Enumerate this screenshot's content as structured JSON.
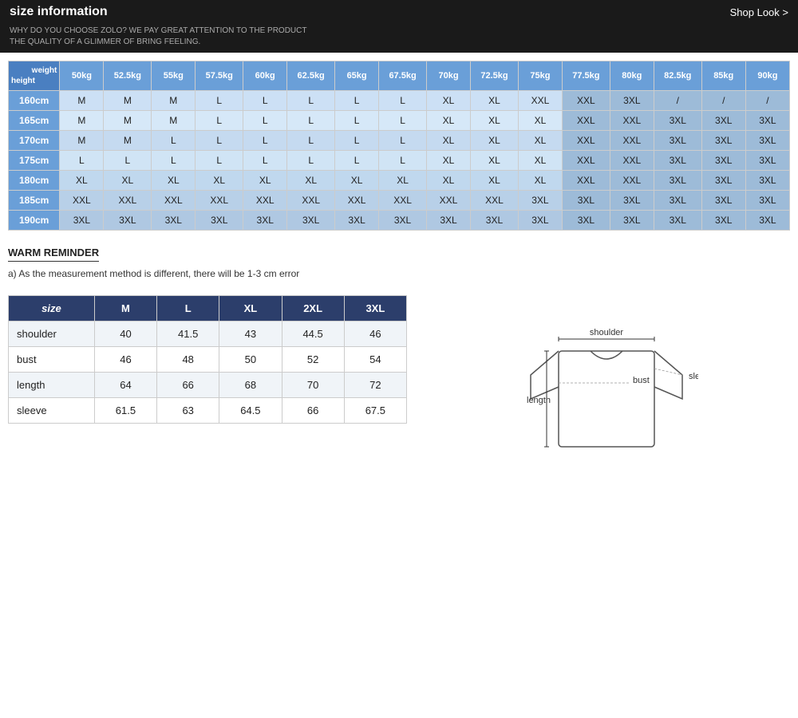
{
  "header": {
    "title": "size information",
    "shop_look": "Shop Look >"
  },
  "tagline": {
    "line1": "WHY DO YOU CHOOSE ZOLO? WE PAY GREAT ATTENTION TO THE PRODUCT",
    "line2": "THE QUALITY OF A GLIMMER OF BRING FEELING."
  },
  "matrix": {
    "corner_weight": "weight",
    "corner_height": "height",
    "weight_headers": [
      "50kg",
      "52.5kg",
      "55kg",
      "57.5kg",
      "60kg",
      "62.5kg",
      "65kg",
      "67.5kg",
      "70kg",
      "72.5kg",
      "75kg",
      "77.5kg",
      "80kg",
      "82.5kg",
      "85kg",
      "90kg"
    ],
    "rows": [
      {
        "height": "160cm",
        "values": [
          "M",
          "M",
          "M",
          "L",
          "L",
          "L",
          "L",
          "L",
          "XL",
          "XL",
          "XXL",
          "XXL",
          "3XL",
          "/",
          "/",
          "/"
        ]
      },
      {
        "height": "165cm",
        "values": [
          "M",
          "M",
          "M",
          "L",
          "L",
          "L",
          "L",
          "L",
          "XL",
          "XL",
          "XL",
          "XXL",
          "XXL",
          "3XL",
          "3XL",
          "3XL"
        ]
      },
      {
        "height": "170cm",
        "values": [
          "M",
          "M",
          "L",
          "L",
          "L",
          "L",
          "L",
          "L",
          "XL",
          "XL",
          "XL",
          "XXL",
          "XXL",
          "3XL",
          "3XL",
          "3XL"
        ]
      },
      {
        "height": "175cm",
        "values": [
          "L",
          "L",
          "L",
          "L",
          "L",
          "L",
          "L",
          "L",
          "XL",
          "XL",
          "XL",
          "XXL",
          "XXL",
          "3XL",
          "3XL",
          "3XL"
        ]
      },
      {
        "height": "180cm",
        "values": [
          "XL",
          "XL",
          "XL",
          "XL",
          "XL",
          "XL",
          "XL",
          "XL",
          "XL",
          "XL",
          "XL",
          "XXL",
          "XXL",
          "3XL",
          "3XL",
          "3XL"
        ]
      },
      {
        "height": "185cm",
        "values": [
          "XXL",
          "XXL",
          "XXL",
          "XXL",
          "XXL",
          "XXL",
          "XXL",
          "XXL",
          "XXL",
          "XXL",
          "3XL",
          "3XL",
          "3XL",
          "3XL",
          "3XL",
          "3XL"
        ]
      },
      {
        "height": "190cm",
        "values": [
          "3XL",
          "3XL",
          "3XL",
          "3XL",
          "3XL",
          "3XL",
          "3XL",
          "3XL",
          "3XL",
          "3XL",
          "3XL",
          "3XL",
          "3XL",
          "3XL",
          "3XL",
          "3XL"
        ]
      }
    ]
  },
  "warm_reminder": {
    "title": "WARM REMINDER",
    "items": [
      "a)  As the measurement method is different, there will be 1-3 cm error"
    ]
  },
  "size_detail": {
    "headers": [
      "size",
      "M",
      "L",
      "XL",
      "2XL",
      "3XL"
    ],
    "rows": [
      {
        "label": "shoulder",
        "values": [
          "40",
          "41.5",
          "43",
          "44.5",
          "46"
        ]
      },
      {
        "label": "bust",
        "values": [
          "46",
          "48",
          "50",
          "52",
          "54"
        ]
      },
      {
        "label": "length",
        "values": [
          "64",
          "66",
          "68",
          "70",
          "72"
        ]
      },
      {
        "label": "sleeve",
        "values": [
          "61.5",
          "63",
          "64.5",
          "66",
          "67.5"
        ]
      }
    ]
  },
  "diagram": {
    "shoulder_label": "shoulder",
    "bust_label": "bust",
    "length_label": "length",
    "sleeve_label": "sleeve"
  }
}
